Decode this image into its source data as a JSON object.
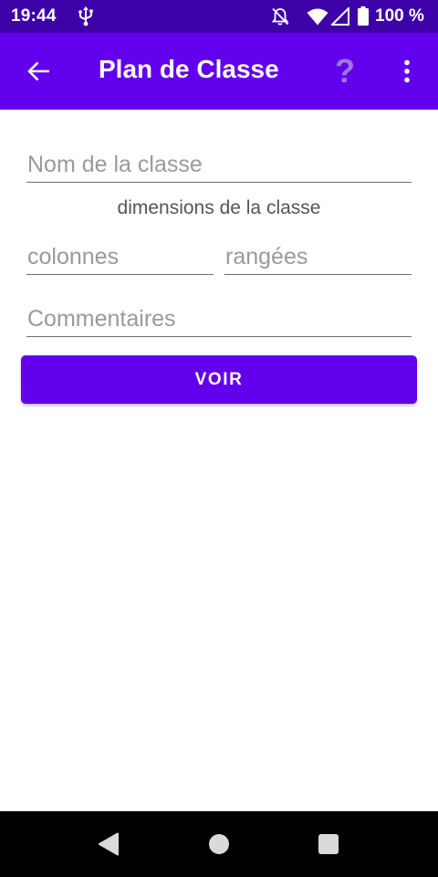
{
  "status_bar": {
    "time": "19:44",
    "battery": "100 %",
    "icons": [
      "usb-icon",
      "bell-off-icon",
      "wifi-icon",
      "signal-icon",
      "battery-icon"
    ]
  },
  "app_bar": {
    "title": "Plan de Classe",
    "back_icon": "arrow-left-icon",
    "help_label": "?",
    "overflow_icon": "more-vert-icon"
  },
  "form": {
    "class_name": {
      "value": "",
      "placeholder": "Nom de la classe"
    },
    "dimensions_label": "dimensions de la classe",
    "columns": {
      "value": "",
      "placeholder": "colonnes"
    },
    "rows": {
      "value": "",
      "placeholder": "rangées"
    },
    "comments": {
      "value": "",
      "placeholder": "Commentaires"
    },
    "submit_label": "VOIR"
  },
  "colors": {
    "status_bar": "#3d01a8",
    "app_bar": "#6200ee",
    "button": "#6200ee",
    "help_icon": "#9b7bd9"
  },
  "nav_bar": {
    "icons": [
      "nav-back-icon",
      "nav-home-icon",
      "nav-recents-icon"
    ]
  }
}
